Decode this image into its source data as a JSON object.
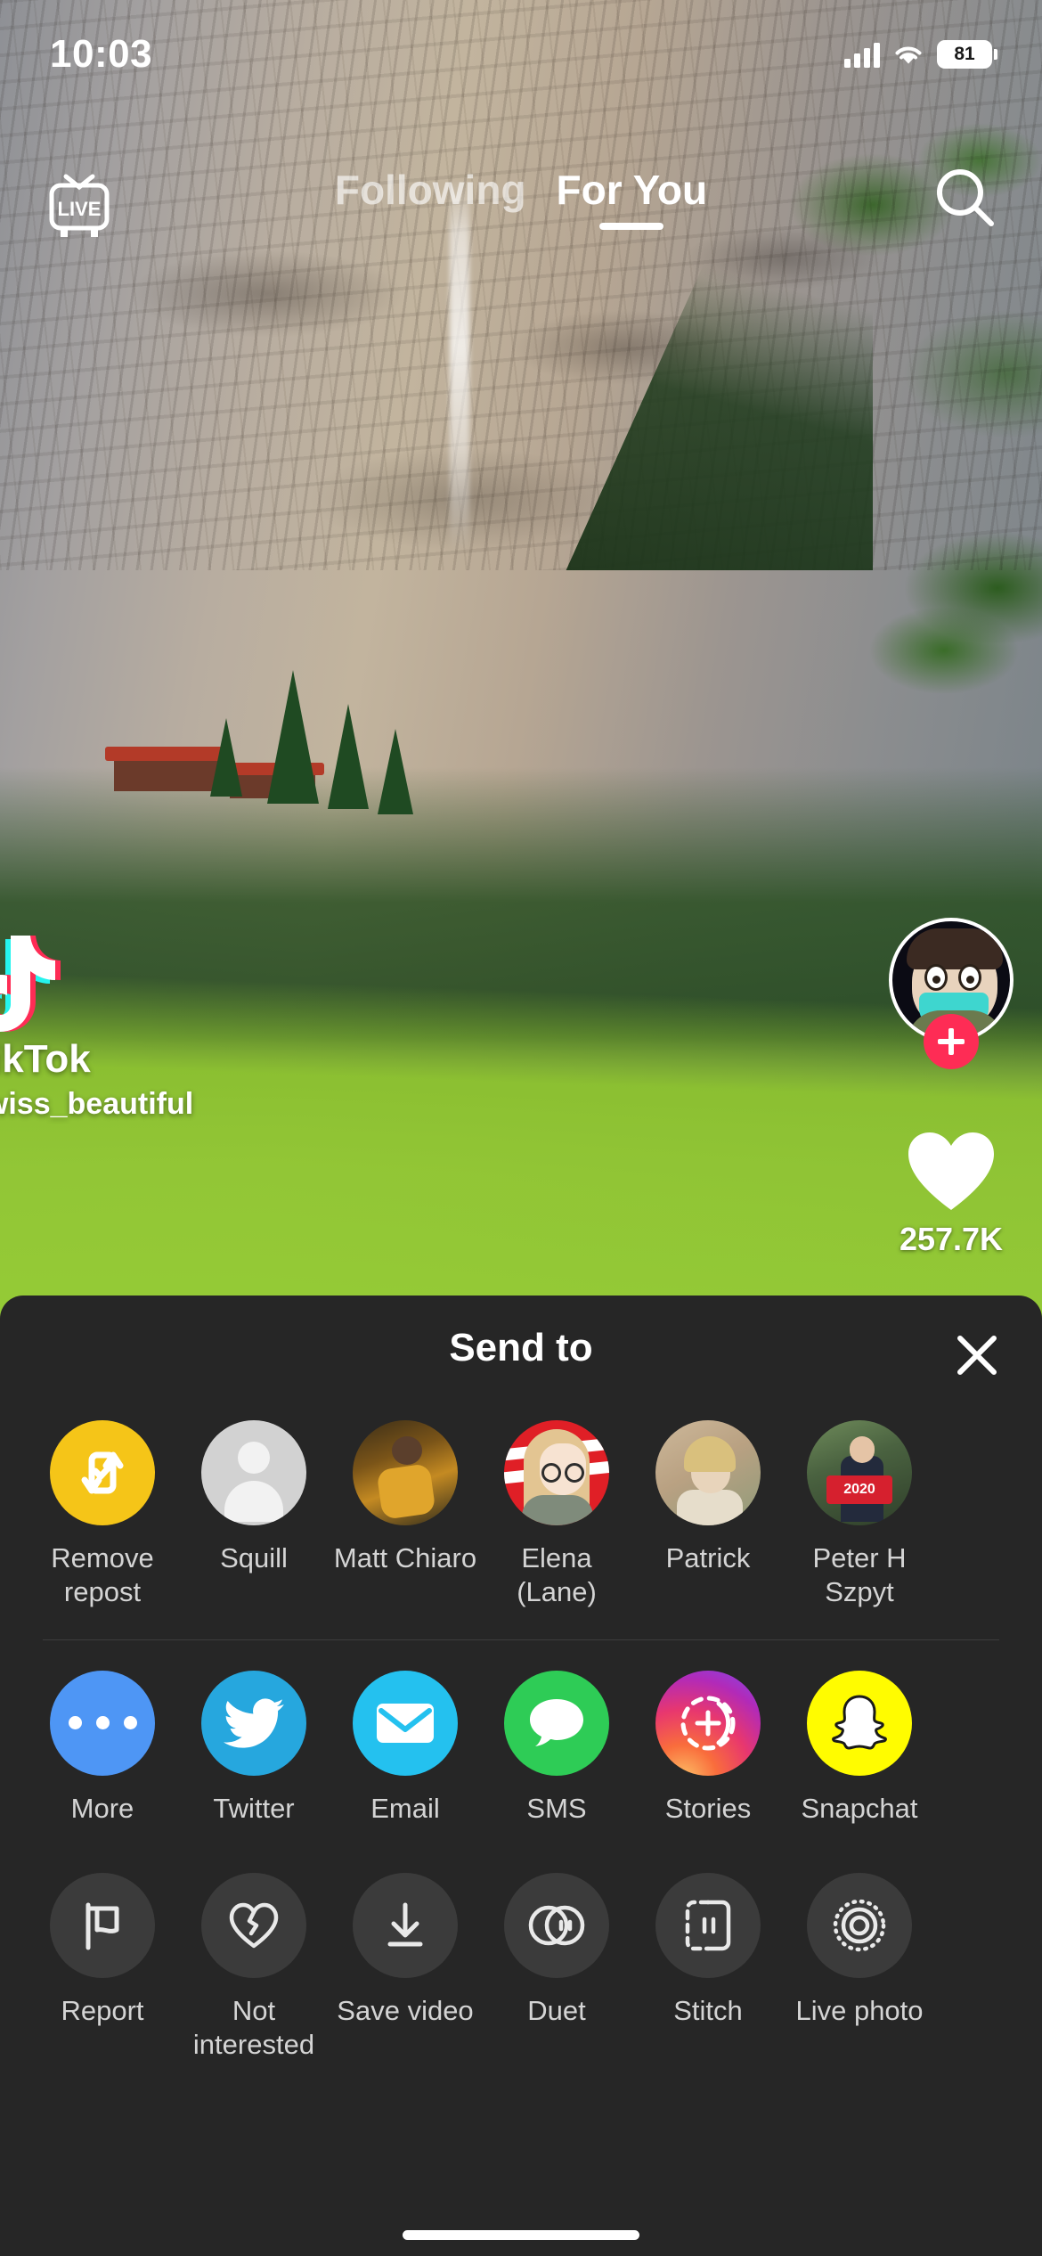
{
  "status_bar": {
    "time": "10:03",
    "battery_level": "81",
    "signal_icon": "cellular-bars-icon",
    "wifi_icon": "wifi-icon",
    "battery_icon": "battery-icon"
  },
  "top_nav": {
    "live_label": "LIVE",
    "live_icon": "live-tv-icon",
    "search_icon": "search-icon",
    "tabs": [
      {
        "label": "Following",
        "active": false
      },
      {
        "label": "For You",
        "active": true
      }
    ]
  },
  "video": {
    "watermark_brand": "TikTok",
    "watermark_logo_icon": "tiktok-note-icon",
    "watermark_username": "swiss_beautiful",
    "like_count": "257.7K",
    "like_icon": "heart-icon",
    "avatar_icon": "user-avatar",
    "follow_icon": "plus-icon"
  },
  "share_sheet": {
    "title": "Send to",
    "close_icon": "close-icon",
    "contacts": [
      {
        "label": "Remove repost",
        "icon": "repost-icon",
        "color": "#F5C518",
        "kind": "repost"
      },
      {
        "label": "Squill",
        "icon": "default-avatar",
        "color": "#D2D2D2",
        "kind": "default"
      },
      {
        "label": "Matt Chiaro",
        "icon": "contact-avatar",
        "color": "#7A5418",
        "kind": "matt"
      },
      {
        "label": "Elena (Lane)",
        "icon": "contact-avatar",
        "color": "#E01F26",
        "kind": "elena"
      },
      {
        "label": "Patrick",
        "icon": "contact-avatar",
        "color": "#B9A182",
        "kind": "patrick"
      },
      {
        "label": "Peter H Szpyt",
        "icon": "contact-avatar",
        "color": "#4A6240",
        "kind": "peter"
      }
    ],
    "apps": [
      {
        "label": "More",
        "icon": "more-dots-icon",
        "color": "#4E96F5"
      },
      {
        "label": "Twitter",
        "icon": "twitter-bird-icon",
        "color": "#26A7DE"
      },
      {
        "label": "Email",
        "icon": "envelope-icon",
        "color": "#24C1EF"
      },
      {
        "label": "SMS",
        "icon": "speech-bubble-icon",
        "color": "#2ECC56"
      },
      {
        "label": "Stories",
        "icon": "instagram-stories-icon",
        "color": "#E8376E"
      },
      {
        "label": "Snapchat",
        "icon": "snapchat-ghost-icon",
        "color": "#FFFC00"
      }
    ],
    "actions": [
      {
        "label": "Report",
        "icon": "flag-icon",
        "color": "#3B3B3B"
      },
      {
        "label": "Not interested",
        "icon": "broken-heart-icon",
        "color": "#3B3B3B"
      },
      {
        "label": "Save video",
        "icon": "download-icon",
        "color": "#3B3B3B"
      },
      {
        "label": "Duet",
        "icon": "duet-circles-icon",
        "color": "#3B3B3B"
      },
      {
        "label": "Stitch",
        "icon": "stitch-frame-icon",
        "color": "#3B3B3B"
      },
      {
        "label": "Live photo",
        "icon": "live-photo-icon",
        "color": "#3B3B3B"
      }
    ],
    "peter_sign_text": "2020"
  },
  "home_indicator": "home-indicator"
}
